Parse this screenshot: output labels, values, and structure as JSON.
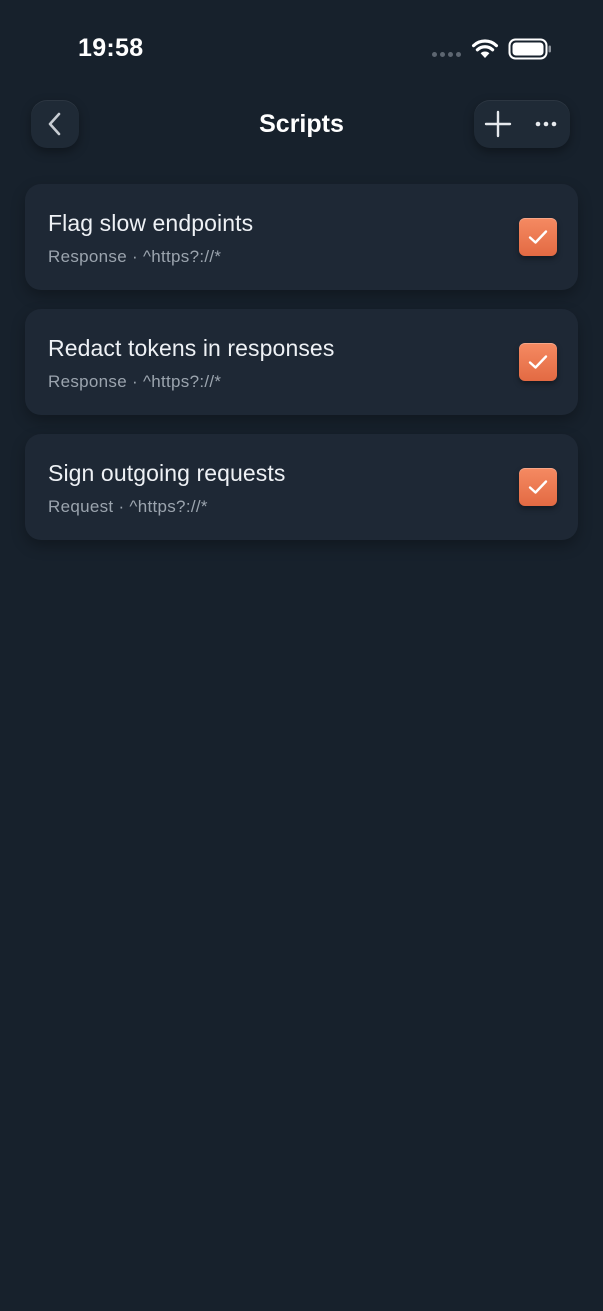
{
  "status_bar": {
    "time": "19:58"
  },
  "nav": {
    "title": "Scripts",
    "back_icon": "chevron-left-icon",
    "add_icon": "plus-icon",
    "more_icon": "ellipsis-icon"
  },
  "scripts": [
    {
      "title": "Flag slow endpoints",
      "subtitle": "Response · ^https?://*",
      "enabled": true
    },
    {
      "title": "Redact tokens in responses",
      "subtitle": "Response · ^https?://*",
      "enabled": true
    },
    {
      "title": "Sign outgoing requests",
      "subtitle": "Request · ^https?://*",
      "enabled": true
    }
  ],
  "colors": {
    "background": "#17212c",
    "card": "#1e2835",
    "accent": "#ee7a52"
  }
}
